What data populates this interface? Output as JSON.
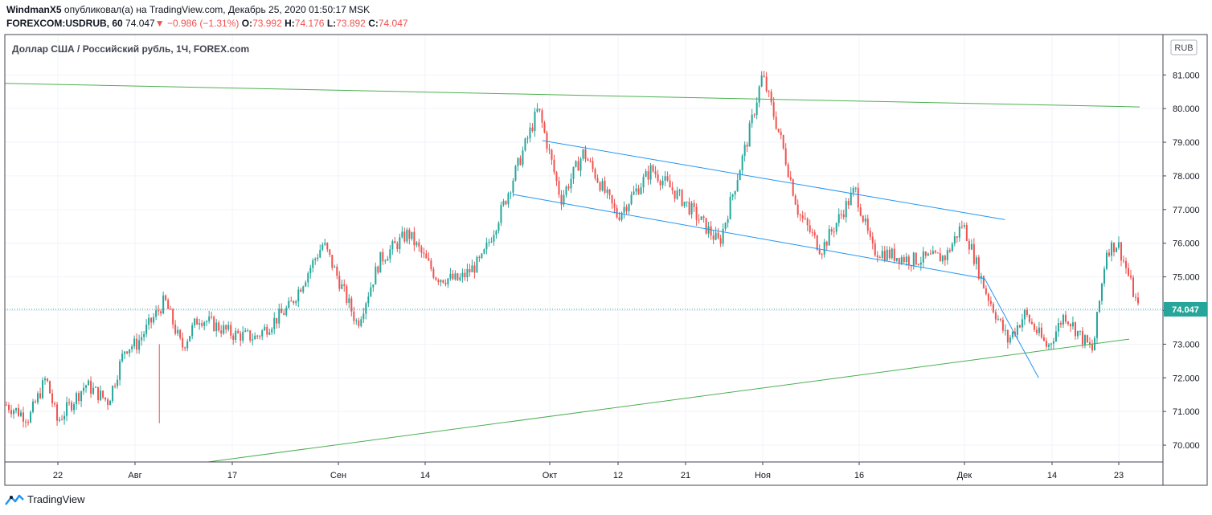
{
  "header": {
    "author": "WindmanX5",
    "published": "опубликовал(а) на TradingView.com, Декабрь 25, 2020 01:50:17 MSK",
    "symbol": "FOREXCOM:USDRUB, 60",
    "last": "74.047",
    "change": "−0.986 (−1.31%)",
    "open_label": "O:",
    "open": "73.992",
    "high_label": "H:",
    "high": "74.176",
    "low_label": "L:",
    "low": "73.892",
    "close_label": "C:",
    "close": "74.047"
  },
  "footer": {
    "brand": "TradingView"
  },
  "colors": {
    "up": "#26a69a",
    "down": "#ef5350",
    "trendline_green": "#4caf50",
    "trendline_blue": "#2196f3",
    "grid": "#f0f3fa",
    "price_tag": "#26a69a"
  },
  "chart_data": {
    "type": "candlestick",
    "title": "Доллар США / Российский рубль, 1Ч, FOREX.com",
    "currency": "RUB",
    "ylim": [
      69.5,
      82.2
    ],
    "yticks": [
      "70.000",
      "71.000",
      "72.000",
      "73.000",
      "74.000",
      "75.000",
      "76.000",
      "77.000",
      "78.000",
      "79.000",
      "80.000",
      "81.000"
    ],
    "xticks": [
      "22",
      "Авг",
      "17",
      "Сен",
      "14",
      "Окт",
      "12",
      "21",
      "Ноя",
      "16",
      "Дек",
      "14",
      "23"
    ],
    "last_price": "74.047",
    "price_path": [
      [
        0,
        71.2
      ],
      [
        0.02,
        70.8
      ],
      [
        0.035,
        72.0
      ],
      [
        0.045,
        70.7
      ],
      [
        0.07,
        71.8
      ],
      [
        0.09,
        71.3
      ],
      [
        0.105,
        72.9
      ],
      [
        0.115,
        73.0
      ],
      [
        0.14,
        74.3
      ],
      [
        0.155,
        72.9
      ],
      [
        0.17,
        73.8
      ],
      [
        0.2,
        73.3
      ],
      [
        0.22,
        73.2
      ],
      [
        0.25,
        74.1
      ],
      [
        0.28,
        76.0
      ],
      [
        0.31,
        73.6
      ],
      [
        0.33,
        75.5
      ],
      [
        0.355,
        76.3
      ],
      [
        0.38,
        75.0
      ],
      [
        0.4,
        74.9
      ],
      [
        0.42,
        75.5
      ],
      [
        0.44,
        77.2
      ],
      [
        0.47,
        80.0
      ],
      [
        0.49,
        77.3
      ],
      [
        0.51,
        78.7
      ],
      [
        0.54,
        76.8
      ],
      [
        0.57,
        78.2
      ],
      [
        0.6,
        77.2
      ],
      [
        0.63,
        76.0
      ],
      [
        0.655,
        79.1
      ],
      [
        0.668,
        81.0
      ],
      [
        0.685,
        79.0
      ],
      [
        0.7,
        76.9
      ],
      [
        0.72,
        75.8
      ],
      [
        0.75,
        77.6
      ],
      [
        0.765,
        75.8
      ],
      [
        0.8,
        75.5
      ],
      [
        0.83,
        75.6
      ],
      [
        0.845,
        76.6
      ],
      [
        0.865,
        74.6
      ],
      [
        0.885,
        73.1
      ],
      [
        0.9,
        73.9
      ],
      [
        0.92,
        72.9
      ],
      [
        0.935,
        73.9
      ],
      [
        0.95,
        73.2
      ],
      [
        0.96,
        72.8
      ],
      [
        0.972,
        75.8
      ],
      [
        0.982,
        76.0
      ],
      [
        0.99,
        75.2
      ],
      [
        1.0,
        74.05
      ]
    ],
    "trendlines": [
      {
        "name": "upper-green",
        "color": "green",
        "points": [
          [
            "2020-07-13",
            80.75
          ],
          [
            "2020-12-25",
            80.05
          ]
        ]
      },
      {
        "name": "lower-green",
        "color": "green",
        "points": [
          [
            "2020-08-13",
            69.5
          ],
          [
            "2020-12-24",
            73.15
          ]
        ]
      },
      {
        "name": "channel-top",
        "color": "blue",
        "points": [
          [
            "2020-09-30",
            79.05
          ],
          [
            "2020-12-07",
            76.7
          ]
        ]
      },
      {
        "name": "channel-bottom",
        "color": "blue",
        "points": [
          [
            "2020-09-26",
            77.45
          ],
          [
            "2020-12-04",
            74.95
          ]
        ]
      },
      {
        "name": "breakdown",
        "color": "blue",
        "points": [
          [
            "2020-12-04",
            74.95
          ],
          [
            "2020-12-12",
            72.0
          ]
        ]
      }
    ]
  }
}
